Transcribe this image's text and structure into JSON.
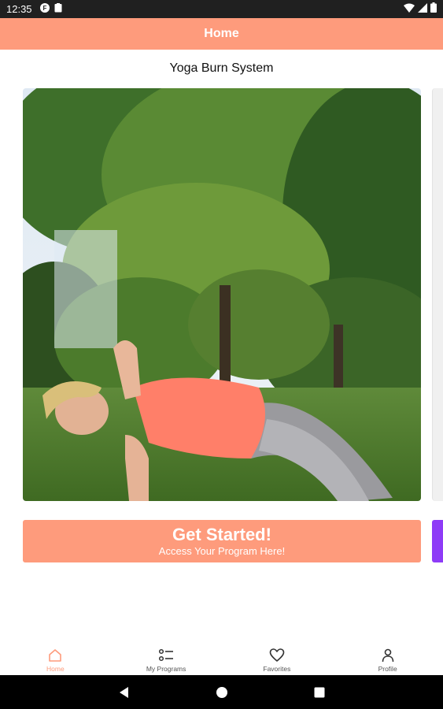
{
  "status_bar": {
    "time": "12:35"
  },
  "app_bar": {
    "title": "Home"
  },
  "program": {
    "title": "Yoga Burn System"
  },
  "cta": {
    "title": "Get Started!",
    "subtitle": "Access Your Program Here!"
  },
  "bottom_nav": {
    "items": [
      {
        "label": "Home",
        "icon": "home-icon",
        "active": true
      },
      {
        "label": "My Programs",
        "icon": "list-icon",
        "active": false
      },
      {
        "label": "Favorites",
        "icon": "heart-icon",
        "active": false
      },
      {
        "label": "Profile",
        "icon": "person-icon",
        "active": false
      }
    ]
  },
  "colors": {
    "accent": "#FE9B7C",
    "secondary_card": "#8E3BF7",
    "status_bar": "#202020",
    "system_nav": "#000000"
  }
}
